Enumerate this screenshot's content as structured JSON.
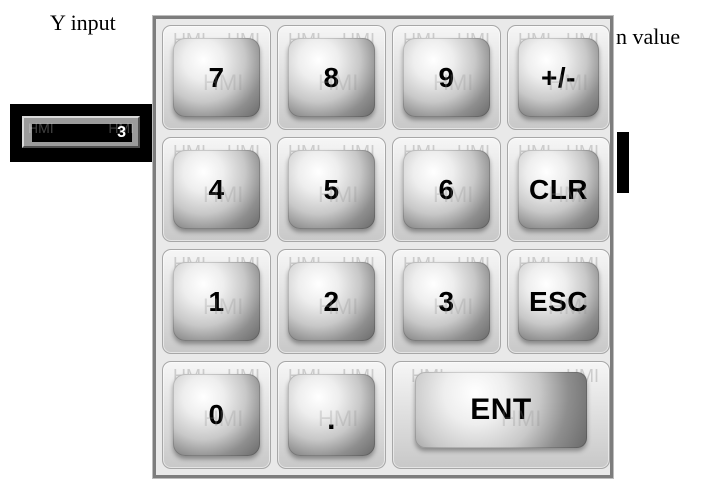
{
  "background_labels": {
    "left": "Y input",
    "right": "n value"
  },
  "input_display": {
    "value": "3",
    "watermark_left": "HMI",
    "watermark_right": "HMI"
  },
  "keypad": {
    "watermark": "HMI",
    "keys": [
      {
        "label": "7"
      },
      {
        "label": "8"
      },
      {
        "label": "9"
      },
      {
        "label": "+/-"
      },
      {
        "label": "4"
      },
      {
        "label": "5"
      },
      {
        "label": "6"
      },
      {
        "label": "CLR"
      },
      {
        "label": "1"
      },
      {
        "label": "2"
      },
      {
        "label": "3"
      },
      {
        "label": "ESC"
      },
      {
        "label": "0"
      },
      {
        "label": "."
      },
      {
        "label": "ENT"
      }
    ]
  }
}
